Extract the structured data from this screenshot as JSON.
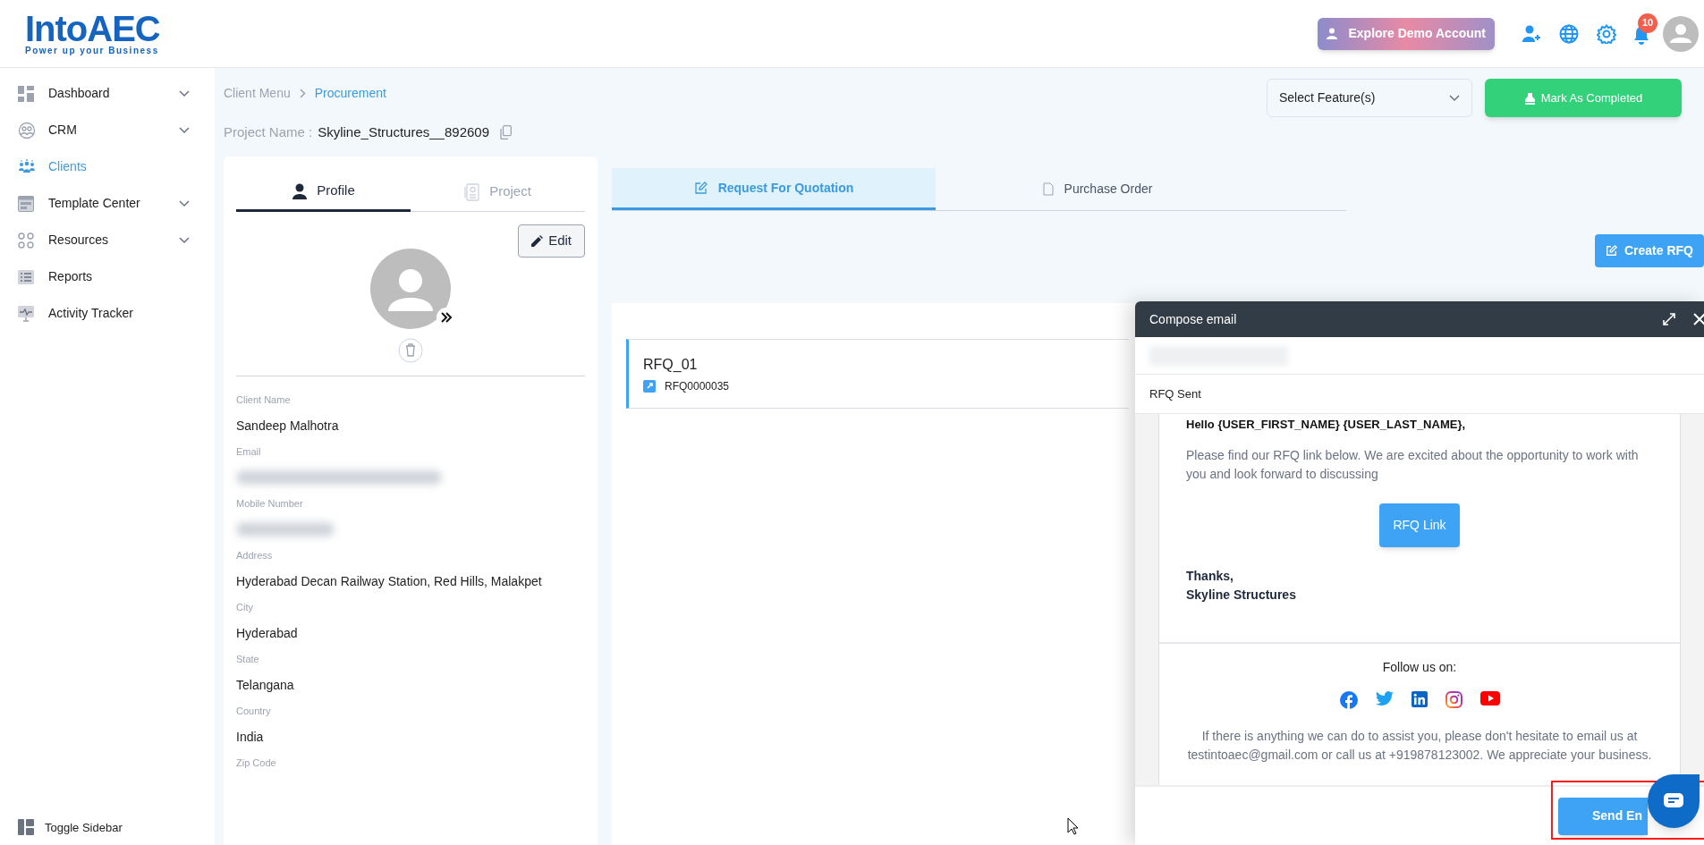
{
  "logo": {
    "name": "IntoAEC",
    "tagline": "Power up your Business"
  },
  "header": {
    "demo_button": "Explore Demo Account",
    "notification_count": "10"
  },
  "sidebar": {
    "items": [
      {
        "label": "Dashboard",
        "selected": false,
        "has_submenu": true
      },
      {
        "label": "CRM",
        "selected": false,
        "has_submenu": true
      },
      {
        "label": "Clients",
        "selected": true,
        "has_submenu": false
      },
      {
        "label": "Template Center",
        "selected": false,
        "has_submenu": true
      },
      {
        "label": "Resources",
        "selected": false,
        "has_submenu": true
      },
      {
        "label": "Reports",
        "selected": false,
        "has_submenu": false
      },
      {
        "label": "Activity Tracker",
        "selected": false,
        "has_submenu": false
      }
    ],
    "toggle": "Toggle Sidebar"
  },
  "breadcrumb": [
    {
      "label": "Client Menu",
      "current": false
    },
    {
      "label": "Procurement",
      "current": true
    }
  ],
  "project": {
    "label": "Project Name :",
    "value": "Skyline_Structures__892609"
  },
  "feature_select": {
    "placeholder": "Select Feature(s)"
  },
  "complete_button": "Mark As Completed",
  "profile": {
    "tabs": [
      {
        "label": "Profile",
        "selected": true
      },
      {
        "label": "Project",
        "selected": false
      }
    ],
    "edit_button": "Edit",
    "fields": [
      {
        "label": "Client Name",
        "value": "Sandeep Malhotra",
        "kind": "text"
      },
      {
        "label": "Email",
        "kind": "redacted"
      },
      {
        "label": "Mobile Number",
        "kind": "redacted"
      },
      {
        "label": "Address",
        "value": "Hyderabad Decan Railway Station, Red Hills, Malakpet",
        "kind": "text"
      },
      {
        "label": "City",
        "value": "Hyderabad",
        "kind": "text"
      },
      {
        "label": "State",
        "value": "Telangana",
        "kind": "text"
      },
      {
        "label": "Country",
        "value": "India",
        "kind": "text"
      },
      {
        "label": "Zip Code",
        "kind": "text"
      }
    ]
  },
  "tabs": [
    {
      "label": "Request For Quotation",
      "selected": true
    },
    {
      "label": "Purchase Order",
      "selected": false
    }
  ],
  "create_button": "Create RFQ",
  "rfqs": [
    {
      "title": "RFQ_01",
      "number": "RFQ0000035"
    }
  ],
  "compose": {
    "title": "Compose email",
    "to_redacted": true,
    "subject": "RFQ Sent",
    "greeting": "Hello {USER_FIRST_NAME} {USER_LAST_NAME},",
    "body": "Please find our RFQ link below. We are excited about the opportunity to work with you and look forward to discussing",
    "link_button": "RFQ Link",
    "sign_off": "Thanks,",
    "signature": "Skyline Structures",
    "follow": "Follow us on:",
    "footer_text": "If there is anything we can do to assist you, please don't hesitate to email us at testintoaec@gmail.com or call us at +919878123002. We appreciate your business.",
    "send_button": "Send En"
  }
}
